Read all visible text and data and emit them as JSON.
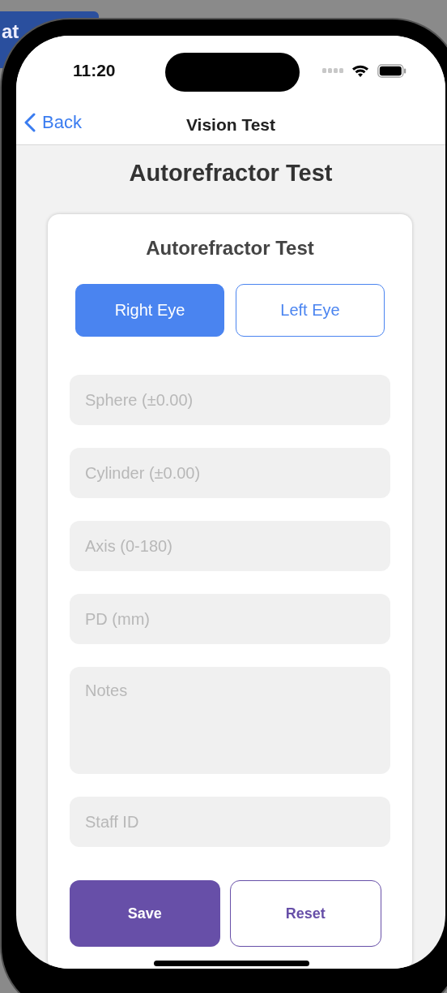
{
  "desktop_tab": {
    "label": "at"
  },
  "status_bar": {
    "time": "11:20"
  },
  "nav_bar": {
    "back_label": "Back",
    "title": "Vision Test"
  },
  "page_heading": "Autorefractor Test",
  "card": {
    "title": "Autorefractor Test",
    "eye_tabs": [
      {
        "label": "Right Eye",
        "selected": true
      },
      {
        "label": "Left Eye",
        "selected": false
      }
    ],
    "fields": [
      {
        "kind": "input",
        "placeholder": "Sphere (±0.00)"
      },
      {
        "kind": "input",
        "placeholder": "Cylinder (±0.00)"
      },
      {
        "kind": "input",
        "placeholder": "Axis (0-180)"
      },
      {
        "kind": "input",
        "placeholder": "PD (mm)"
      },
      {
        "kind": "multiline",
        "placeholder": "Notes"
      },
      {
        "kind": "input",
        "placeholder": "Staff ID"
      }
    ],
    "buttons": [
      {
        "kind": "primary",
        "label": "Save"
      },
      {
        "kind": "secondary",
        "label": "Reset"
      }
    ]
  }
}
